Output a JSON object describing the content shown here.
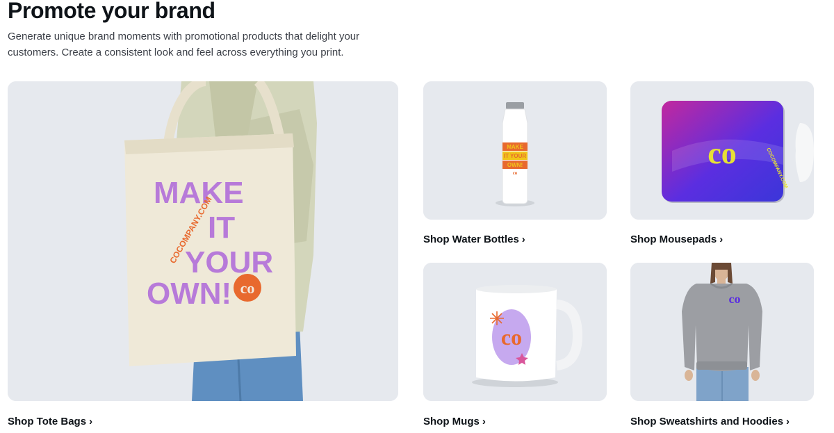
{
  "section": {
    "title": "Promote your brand",
    "description": "Generate unique brand moments with promotional products that delight your customers. Create a consistent look and feel across everything you print."
  },
  "products": [
    {
      "label": "Shop Tote Bags",
      "image": "tote-bag-image"
    },
    {
      "label": "Shop Water Bottles",
      "image": "water-bottle-image"
    },
    {
      "label": "Shop Mousepads",
      "image": "mousepad-image"
    },
    {
      "label": "Shop Mugs",
      "image": "mug-image"
    },
    {
      "label": "Shop Sweatshirts and Hoodies",
      "image": "sweatshirt-image"
    }
  ],
  "artwork": {
    "tote_lines": [
      "MAKE",
      "IT",
      "YOUR",
      "OWN!"
    ],
    "bottle_lines": [
      "MAKE",
      "IT YOUR",
      "OWN!"
    ],
    "brand_url": "COCOMPANY.COM",
    "logo_text": "co"
  },
  "icons": {
    "chevron": "chevron-right-icon"
  },
  "colors": {
    "tile_bg": "#e6e9ee",
    "purple": "#b77ad9",
    "orange": "#e8692e",
    "mousepad_gradient": [
      "#c2289e",
      "#5b2ee0",
      "#3b36d9"
    ]
  }
}
